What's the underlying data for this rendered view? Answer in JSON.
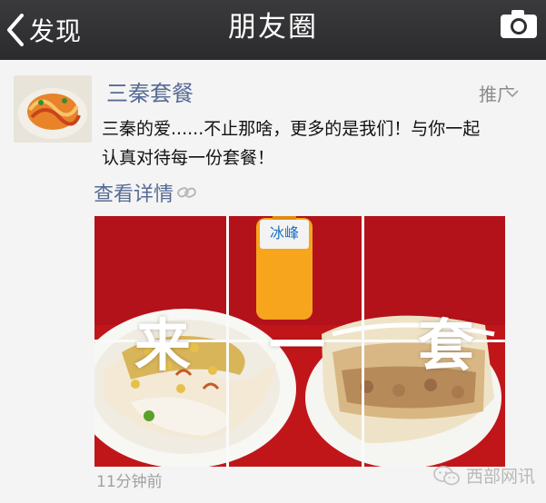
{
  "nav": {
    "back_label": "发现",
    "title": "朋友圈",
    "back_icon": "chevron-left-icon",
    "camera_icon": "camera-icon"
  },
  "post": {
    "name": "三秦套餐",
    "promo_label": "推广",
    "text_line1": "三秦的爱......不止那啥，更多的是我们！与你一起",
    "text_line2": "认真对待每一份套餐！",
    "detail_link": "查看详情",
    "timestamp": "11分钟前"
  },
  "photo": {
    "overlay_chars": [
      "来",
      "一",
      "套"
    ],
    "bottle_label": "冰峰"
  },
  "watermark": {
    "text": "西部网讯"
  },
  "colors": {
    "navbar": "#2f2f31",
    "link": "#576b95",
    "background": "#f4f4f4",
    "photo_red": "#c0161a"
  }
}
